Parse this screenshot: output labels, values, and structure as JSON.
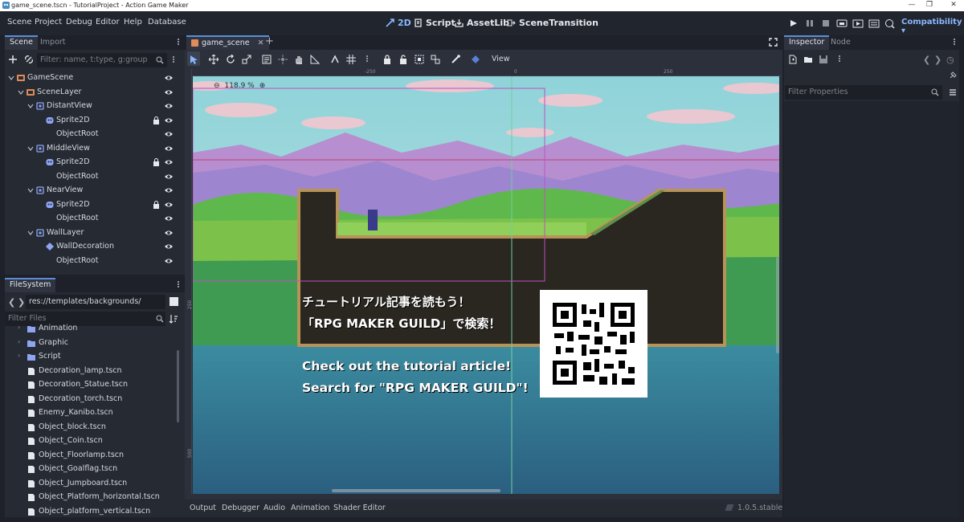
{
  "window": {
    "title": "game_scene.tscn - TutorialProject - Action Game Maker",
    "minimize": "—",
    "maximize": "❐",
    "close": "✕"
  },
  "menu": [
    "Scene",
    "Project",
    "Debug",
    "Editor",
    "Help",
    "Database"
  ],
  "workspaces": {
    "w2d": "2D",
    "script": "Script",
    "assetlib": "AssetLib",
    "scene_transition": "SceneTransition"
  },
  "renderer": "Compatibility",
  "left_top": {
    "tab_scene": "Scene",
    "tab_import": "Import",
    "filter_placeholder": "Filter: name, t:type, g:group"
  },
  "scene_tree": [
    {
      "label": "GameScene"
    },
    {
      "label": "SceneLayer"
    },
    {
      "label": "DistantView"
    },
    {
      "label": "Sprite2D"
    },
    {
      "label": "ObjectRoot"
    },
    {
      "label": "MiddleView"
    },
    {
      "label": "Sprite2D"
    },
    {
      "label": "ObjectRoot"
    },
    {
      "label": "NearView"
    },
    {
      "label": "Sprite2D"
    },
    {
      "label": "ObjectRoot"
    },
    {
      "label": "WallLayer"
    },
    {
      "label": "WallDecoration"
    },
    {
      "label": "ObjectRoot"
    }
  ],
  "filesystem": {
    "tab": "FileSystem",
    "path": "res://templates/backgrounds/",
    "filter_placeholder": "Filter Files",
    "items": [
      {
        "label": "Animation"
      },
      {
        "label": "Graphic"
      },
      {
        "label": "Script"
      },
      {
        "label": "Decoration_lamp.tscn"
      },
      {
        "label": "Decoration_Statue.tscn"
      },
      {
        "label": "Decoration_torch.tscn"
      },
      {
        "label": "Enemy_Kanibo.tscn"
      },
      {
        "label": "Object_block.tscn"
      },
      {
        "label": "Object_Coin.tscn"
      },
      {
        "label": "Object_Floorlamp.tscn"
      },
      {
        "label": "Object_Goalflag.tscn"
      },
      {
        "label": "Object_Jumpboard.tscn"
      },
      {
        "label": "Object_Platform_horizontal.tscn"
      },
      {
        "label": "Object_platform_vertical.tscn"
      }
    ]
  },
  "editor": {
    "scene_tab": "game_scene",
    "view_menu": "View",
    "zoom": "118.9 %",
    "ruler_labels": [
      "-250",
      "0",
      "250",
      "500"
    ],
    "dialog_jp_1": "チュートリアル記事を読もう！",
    "dialog_jp_2": "「RPG MAKER GUILD」で検索！",
    "dialog_en_1": "Check out the tutorial article!",
    "dialog_en_2": "Search for \"RPG MAKER GUILD\"!"
  },
  "inspector": {
    "tab_inspector": "Inspector",
    "tab_node": "Node",
    "filter_placeholder": "Filter Properties"
  },
  "bottom": {
    "tabs": [
      "Output",
      "Debugger",
      "Audio",
      "Animation",
      "Shader Editor"
    ],
    "version": "1.0.5.stable"
  },
  "colors": {
    "accent": "#8ab8ff",
    "panel": "#262a33",
    "background": "#1e2129",
    "node_icon": "#8da5f3"
  }
}
